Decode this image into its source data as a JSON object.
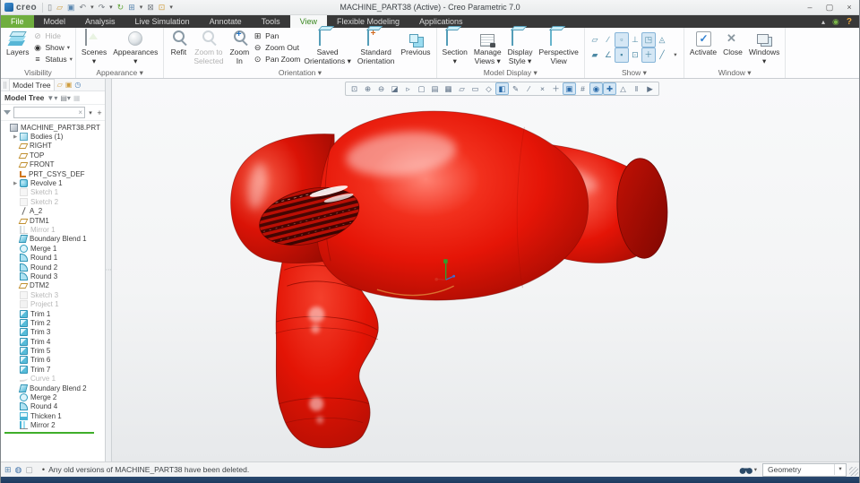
{
  "window": {
    "brand": "creo",
    "title": "MACHINE_PART38 (Active) - Creo Parametric 7.0",
    "minimize": "–",
    "maximize": "▢",
    "close": "×"
  },
  "quick_access": [
    {
      "g": "▯",
      "name": "new-file-icon"
    },
    {
      "g": "▱",
      "name": "open-file-icon",
      "cls": "c-tan"
    },
    {
      "g": "▣",
      "name": "save-icon",
      "cls": "c-blue"
    },
    {
      "g": "↶",
      "name": "undo-icon"
    },
    {
      "g": "▾",
      "name": "undo-dropdown-icon",
      "cls": "caret"
    },
    {
      "g": "↷",
      "name": "redo-icon"
    },
    {
      "g": "▾",
      "name": "redo-dropdown-icon",
      "cls": "caret"
    },
    {
      "g": "↻",
      "name": "regenerate-icon",
      "cls": "c-green"
    },
    {
      "g": "⊞",
      "name": "window-settings-icon",
      "cls": "c-blue"
    },
    {
      "g": "▾",
      "name": "window-settings-dropdown-icon",
      "cls": "caret"
    },
    {
      "g": "⊠",
      "name": "close-window-icon"
    },
    {
      "g": "⊡",
      "name": "new-window-icon",
      "cls": "c-tan"
    },
    {
      "g": "▾",
      "name": "customize-toolbar-icon",
      "cls": "caret"
    }
  ],
  "menu": {
    "tabs": [
      {
        "label": "File",
        "cls": "file",
        "name": "tab-file"
      },
      {
        "label": "Model",
        "name": "tab-model"
      },
      {
        "label": "Analysis",
        "name": "tab-analysis"
      },
      {
        "label": "Live Simulation",
        "name": "tab-live-simulation"
      },
      {
        "label": "Annotate",
        "name": "tab-annotate"
      },
      {
        "label": "Tools",
        "name": "tab-tools"
      },
      {
        "label": "View",
        "cls": "active",
        "name": "tab-view"
      },
      {
        "label": "Flexible Modeling",
        "name": "tab-flexible-modeling"
      },
      {
        "label": "Applications",
        "name": "tab-applications"
      }
    ],
    "collapse": "▴",
    "user": "◉",
    "help": "?"
  },
  "ribbon": {
    "visibility": {
      "label": "Visibility",
      "layers": "Layers",
      "small": [
        {
          "label": "Hide",
          "g": "⊘",
          "cls": "dim",
          "name": "hide-button",
          "caret": ""
        },
        {
          "label": "Show",
          "g": "◉",
          "name": "show-button",
          "caret": "▾"
        },
        {
          "label": "Status",
          "g": "≡",
          "name": "status-button",
          "caret": "▾"
        }
      ]
    },
    "appearance": {
      "label": "Appearance ▾",
      "scenes": "Scenes\n▾",
      "appearances": "Appearances\n▾"
    },
    "orientation": {
      "label": "Orientation ▾",
      "refit": "Refit",
      "zoom_to_selected": "Zoom to\nSelected",
      "zoom_in": "Zoom\nIn",
      "small": [
        {
          "label": "Pan",
          "g": "⊞",
          "name": "pan-button",
          "caret": ""
        },
        {
          "label": "Zoom Out",
          "g": "⊖",
          "name": "zoom-out-button",
          "caret": ""
        },
        {
          "label": "Pan Zoom",
          "g": "⊙",
          "name": "pan-zoom-button",
          "caret": ""
        }
      ],
      "saved": "Saved\nOrientations ▾",
      "standard": "Standard\nOrientation",
      "previous": "Previous"
    },
    "model_display": {
      "label": "Model Display ▾",
      "section": "Section\n▾",
      "manage_views": "Manage\nViews ▾",
      "display_style": "Display\nStyle ▾",
      "perspective": "Perspective\nView"
    },
    "show": {
      "label": "Show ▾",
      "toggles": [
        {
          "g": "▱",
          "name": "plane-tag-display-toggle"
        },
        {
          "g": "∕",
          "name": "axis-tag-display-toggle"
        },
        {
          "g": "▫",
          "name": "point-tag-display-toggle",
          "cls": "active"
        },
        {
          "g": "⊥",
          "name": "csys-tag-display-toggle"
        },
        {
          "g": "◳",
          "name": "annotation-tag-display-toggle",
          "cls": "active"
        },
        {
          "g": "◬",
          "name": "dragger-display-toggle"
        },
        {
          "g": "",
          "name": "spacer",
          "cls": "caret-cell"
        },
        {
          "g": "▰",
          "name": "plane-display-toggle"
        },
        {
          "g": "∠",
          "name": "axis-display-toggle"
        },
        {
          "g": "▪",
          "name": "point-display-toggle",
          "cls": "active"
        },
        {
          "g": "⊡",
          "name": "csys-display-toggle"
        },
        {
          "g": "＋",
          "name": "spin-center-toggle",
          "cls": "active"
        },
        {
          "g": "╱",
          "name": "annotation-display-toggle"
        },
        {
          "g": "▾",
          "name": "show-more-dropdown",
          "cls": "caret-cell"
        }
      ]
    },
    "window_group": {
      "label": "Window ▾",
      "activate": "Activate",
      "close": "Close",
      "windows": "Windows\n▾"
    }
  },
  "graphics_toolbar": [
    {
      "g": "⊡",
      "name": "refit-icon"
    },
    {
      "g": "⊕",
      "name": "zoom-in-icon"
    },
    {
      "g": "⊖",
      "name": "zoom-out-icon"
    },
    {
      "g": "◪",
      "name": "repaint-icon"
    },
    {
      "g": "▹",
      "name": "arrow-select-icon"
    },
    {
      "g": "▢",
      "name": "saved-orientations-icon"
    },
    {
      "g": "▤",
      "name": "view-manager-icon"
    },
    {
      "g": "▦",
      "name": "capture-image-icon"
    },
    {
      "g": "▱",
      "name": "section-view-icon"
    },
    {
      "g": "▭",
      "name": "clipping-icon"
    },
    {
      "g": "◇",
      "name": "perspective-view-icon"
    },
    {
      "g": "◧",
      "name": "display-style-icon",
      "cls": "active"
    },
    {
      "g": "✎",
      "name": "annotation-display-icon"
    },
    {
      "g": "∕",
      "name": "axis-display-icon"
    },
    {
      "g": "×",
      "name": "point-display-icon"
    },
    {
      "g": "＋",
      "name": "csys-display-icon"
    },
    {
      "g": "▣",
      "name": "plane-display-icon",
      "cls": "active"
    },
    {
      "g": "#",
      "name": "tag-display-icon"
    },
    {
      "g": "◉",
      "name": "notes-display-icon",
      "cls": "active"
    },
    {
      "g": "✚",
      "name": "spin-center-icon",
      "cls": "active"
    },
    {
      "g": "△",
      "name": "dragger-icon"
    },
    {
      "g": "‖",
      "name": "pause-icon"
    },
    {
      "g": "▶",
      "name": "resume-icon"
    }
  ],
  "tree_panel": {
    "tab": "Model Tree",
    "header": "Model Tree",
    "search_value": "",
    "items": [
      {
        "label": "MACHINE_PART38.PRT",
        "icon": "part",
        "level": 0
      },
      {
        "label": "Bodies (1)",
        "icon": "bodies",
        "level": 1,
        "cls": "has-arrow"
      },
      {
        "label": "RIGHT",
        "icon": "plane",
        "level": 1
      },
      {
        "label": "TOP",
        "icon": "plane",
        "level": 1
      },
      {
        "label": "FRONT",
        "icon": "plane",
        "level": 1
      },
      {
        "label": "PRT_CSYS_DEF",
        "icon": "csys",
        "level": 1
      },
      {
        "label": "Revolve 1",
        "icon": "revolve",
        "level": 1,
        "cls": "has-arrow"
      },
      {
        "label": "Sketch 1",
        "icon": "sketch",
        "level": 1,
        "cls": "dim"
      },
      {
        "label": "Sketch 2",
        "icon": "sketch",
        "level": 1,
        "cls": "dim"
      },
      {
        "label": "A_2",
        "icon": "axis",
        "level": 1
      },
      {
        "label": "DTM1",
        "icon": "plane",
        "level": 1
      },
      {
        "label": "Mirror 1",
        "icon": "mirror",
        "level": 1,
        "cls": "dim"
      },
      {
        "label": "Boundary Blend 1",
        "icon": "boundary",
        "level": 1
      },
      {
        "label": "Merge 1",
        "icon": "merge",
        "level": 1
      },
      {
        "label": "Round 1",
        "icon": "round",
        "level": 1
      },
      {
        "label": "Round 2",
        "icon": "round",
        "level": 1
      },
      {
        "label": "Round 3",
        "icon": "round",
        "level": 1
      },
      {
        "label": "DTM2",
        "icon": "plane",
        "level": 1
      },
      {
        "label": "Sketch 3",
        "icon": "sketch",
        "level": 1,
        "cls": "dim"
      },
      {
        "label": "Project 1",
        "icon": "project",
        "level": 1,
        "cls": "dim"
      },
      {
        "label": "Trim 1",
        "icon": "trim",
        "level": 1
      },
      {
        "label": "Trim 2",
        "icon": "trim",
        "level": 1
      },
      {
        "label": "Trim 3",
        "icon": "trim",
        "level": 1
      },
      {
        "label": "Trim 4",
        "icon": "trim",
        "level": 1
      },
      {
        "label": "Trim 5",
        "icon": "trim",
        "level": 1
      },
      {
        "label": "Trim 6",
        "icon": "trim",
        "level": 1
      },
      {
        "label": "Trim 7",
        "icon": "trim",
        "level": 1
      },
      {
        "label": "Curve 1",
        "icon": "curve",
        "level": 1,
        "cls": "dim"
      },
      {
        "label": "Boundary Blend 2",
        "icon": "boundary",
        "level": 1
      },
      {
        "label": "Merge 2",
        "icon": "merge",
        "level": 1
      },
      {
        "label": "Round 4",
        "icon": "round",
        "level": 1
      },
      {
        "label": "Thicken 1",
        "icon": "thicken",
        "level": 1
      },
      {
        "label": "Mirror 2",
        "icon": "mirror",
        "level": 1
      }
    ]
  },
  "statusbar": {
    "bullet": "•",
    "message": "Any old versions of MACHINE_PART38 have been deleted.",
    "filter_value": "Geometry"
  },
  "colors": {
    "model_red": "#e81405",
    "model_red_dark": "#9f0b02",
    "model_highlight": "#ff7e6e",
    "file_tab_green": "#6fae3e",
    "active_tab_text": "#39871f",
    "accent_cyan": "#57bcd9",
    "insert_line_green": "#3fae2a"
  }
}
